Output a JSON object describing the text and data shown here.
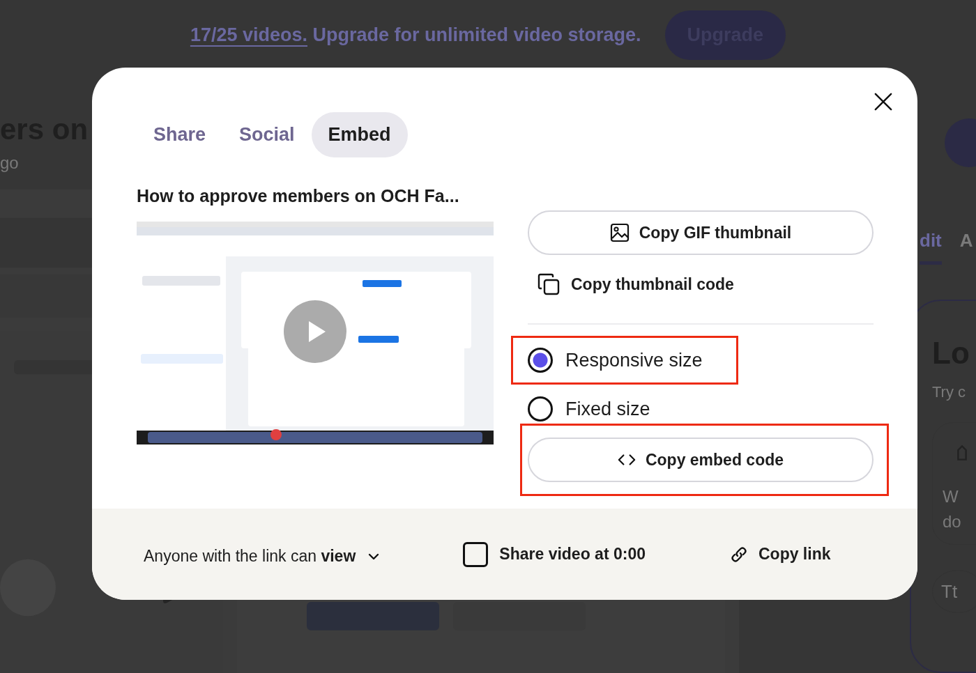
{
  "banner": {
    "link": "17/25 videos.",
    "text": "Upgrade for unlimited video storage.",
    "button": "Upgrade"
  },
  "page": {
    "title": "ers on",
    "subtitle": "go",
    "panel": {
      "tabs": [
        {
          "label": "dit",
          "selected": true
        },
        {
          "label": "A",
          "selected": false
        }
      ],
      "card": {
        "title": "Lo",
        "text": "Try c",
        "option_lines": [
          "W",
          "do"
        ],
        "tool": "Tt"
      }
    }
  },
  "modal": {
    "tabs": [
      {
        "label": "Share",
        "selected": false
      },
      {
        "label": "Social",
        "selected": false
      },
      {
        "label": "Embed",
        "selected": true
      }
    ],
    "title": "How to approve members on OCH Fa...",
    "actions": [
      {
        "kind": "button",
        "label": "Copy GIF thumbnail"
      },
      {
        "kind": "link",
        "label": "Copy thumbnail code"
      }
    ],
    "size_options": [
      {
        "label": "Responsive size",
        "selected": true,
        "highlighted": true
      },
      {
        "label": "Fixed size",
        "selected": false,
        "highlighted": false
      }
    ],
    "embed_button": {
      "label": "Copy embed code",
      "highlighted": true
    },
    "footer": {
      "permission": "Anyone with the link can **view**",
      "share_at": {
        "label": "Share video at 0:00",
        "checked": false
      },
      "copy_link": "Copy link"
    }
  }
}
